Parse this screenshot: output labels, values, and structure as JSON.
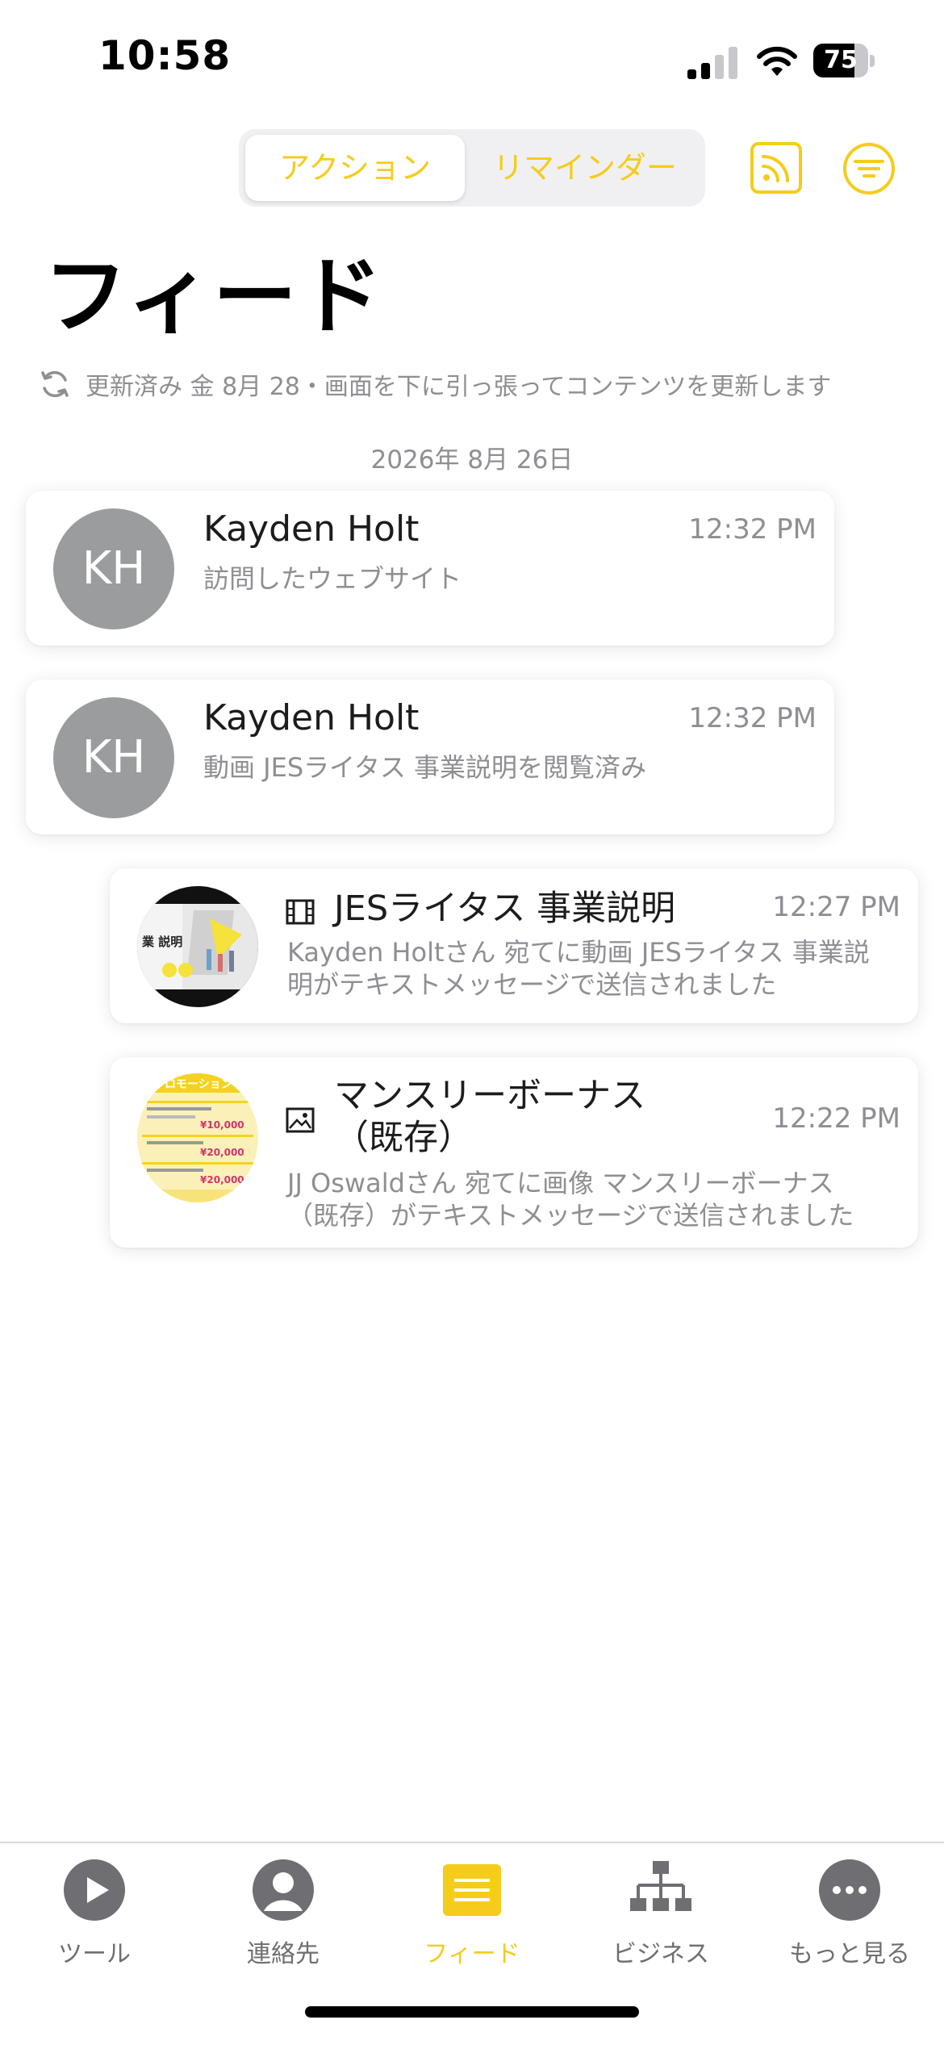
{
  "status_bar": {
    "time": "10:58",
    "battery": "75",
    "battery_level": 0.75
  },
  "segment": {
    "action_label": "アクション",
    "reminder_label": "リマインダー"
  },
  "header": {
    "title": "フィード"
  },
  "refresh": {
    "text": "更新済み 金 8月 28・画面を下に引っ張ってコンテンツを更新します"
  },
  "date_header": "2026年 8月 26日",
  "feed": {
    "items": [
      {
        "initials": "KH",
        "name": "Kayden Holt",
        "subtitle": "訪問したウェブサイト",
        "time": "12:32 PM"
      },
      {
        "initials": "KH",
        "name": "Kayden Holt",
        "subtitle": "動画 JESライタス 事業説明を閲覧済み",
        "time": "12:32 PM"
      }
    ],
    "media": [
      {
        "icon": "film-icon",
        "title": "JESライタス 事業説明",
        "time": "12:27 PM",
        "desc_line1": "Kayden Holtさん 宛てに動画 JESライタス 事業説",
        "desc_line2": "明がテキストメッセージで送信されました",
        "thumb_text": "業 説明"
      },
      {
        "icon": "image-icon",
        "title_line1": "マンスリーボーナス",
        "title_line2": "（既存）",
        "time": "12:22 PM",
        "desc_line1": "JJ Oswaldさん 宛てに画像 マンスリーボーナス",
        "desc_line2": "（既存）がテキストメッセージで送信されました",
        "thumb_text": "プロモーション",
        "thumb_values": [
          "¥10,000",
          "¥20,000",
          "¥20,000"
        ]
      }
    ]
  },
  "tabbar": {
    "tools": "ツール",
    "contacts": "連絡先",
    "feed": "フィード",
    "business": "ビジネス",
    "more": "もっと見る"
  },
  "colors": {
    "accent": "#f5cc1b",
    "gray_icon": "#6e6e73",
    "avatar": "#9b9c9d"
  }
}
